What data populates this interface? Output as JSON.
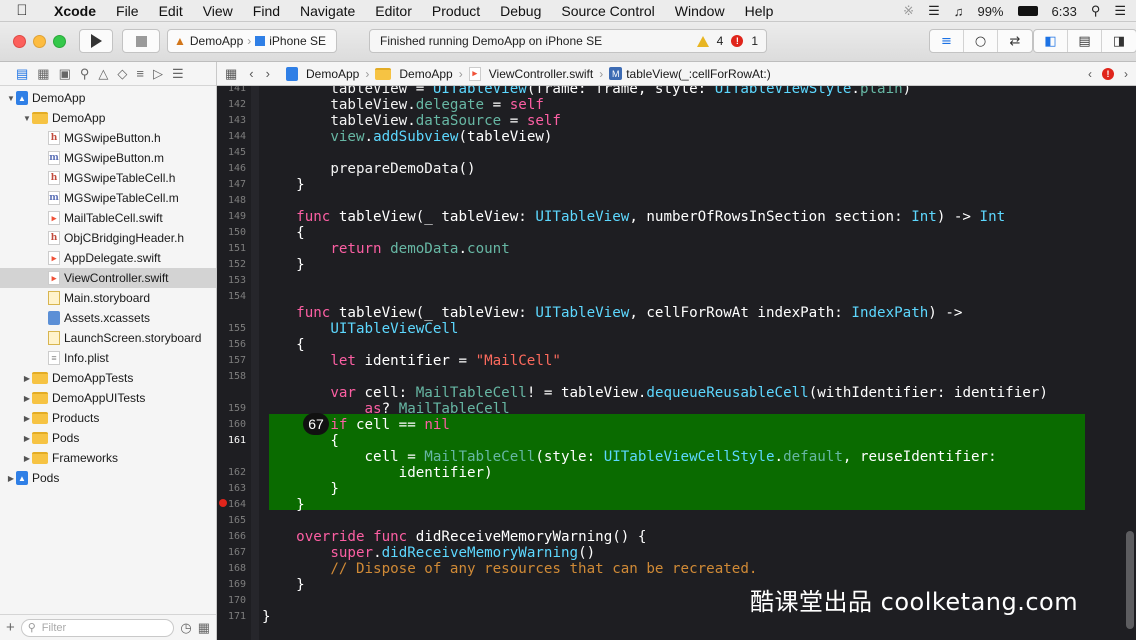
{
  "menubar": {
    "apple": "",
    "items": [
      "Xcode",
      "File",
      "Edit",
      "View",
      "Find",
      "Navigate",
      "Editor",
      "Product",
      "Debug",
      "Source Control",
      "Window",
      "Help"
    ],
    "battery": "99%",
    "time": "6:33"
  },
  "toolbar": {
    "scheme": "DemoApp",
    "device": "iPhone SE",
    "activity": "Finished running DemoApp on iPhone SE",
    "warnings": "4",
    "errors": "1"
  },
  "navigator": {
    "filter_placeholder": "Filter",
    "tree": [
      {
        "label": "DemoApp",
        "icon": "project",
        "indent": 0,
        "disclosure": "▼"
      },
      {
        "label": "DemoApp",
        "icon": "folder",
        "indent": 1,
        "disclosure": "▼"
      },
      {
        "label": "MGSwipeButton.h",
        "icon": "hfile",
        "indent": 2,
        "disclosure": ""
      },
      {
        "label": "MGSwipeButton.m",
        "icon": "mfile",
        "indent": 2,
        "disclosure": ""
      },
      {
        "label": "MGSwipeTableCell.h",
        "icon": "hfile",
        "indent": 2,
        "disclosure": ""
      },
      {
        "label": "MGSwipeTableCell.m",
        "icon": "mfile",
        "indent": 2,
        "disclosure": ""
      },
      {
        "label": "MailTableCell.swift",
        "icon": "swift",
        "indent": 2,
        "disclosure": ""
      },
      {
        "label": "ObjCBridgingHeader.h",
        "icon": "hfile",
        "indent": 2,
        "disclosure": ""
      },
      {
        "label": "AppDelegate.swift",
        "icon": "swift",
        "indent": 2,
        "disclosure": ""
      },
      {
        "label": "ViewController.swift",
        "icon": "swift",
        "indent": 2,
        "disclosure": "",
        "selected": true
      },
      {
        "label": "Main.storyboard",
        "icon": "storyboard",
        "indent": 2,
        "disclosure": ""
      },
      {
        "label": "Assets.xcassets",
        "icon": "assets",
        "indent": 2,
        "disclosure": ""
      },
      {
        "label": "LaunchScreen.storyboard",
        "icon": "storyboard",
        "indent": 2,
        "disclosure": ""
      },
      {
        "label": "Info.plist",
        "icon": "plist",
        "indent": 2,
        "disclosure": ""
      },
      {
        "label": "DemoAppTests",
        "icon": "folder",
        "indent": 1,
        "disclosure": "▶"
      },
      {
        "label": "DemoAppUITests",
        "icon": "folder",
        "indent": 1,
        "disclosure": "▶"
      },
      {
        "label": "Products",
        "icon": "folder",
        "indent": 1,
        "disclosure": "▶"
      },
      {
        "label": "Pods",
        "icon": "folder",
        "indent": 1,
        "disclosure": "▶"
      },
      {
        "label": "Frameworks",
        "icon": "folder",
        "indent": 1,
        "disclosure": "▶"
      },
      {
        "label": "Pods",
        "icon": "project",
        "indent": 0,
        "disclosure": "▶"
      }
    ]
  },
  "jumpbar": {
    "crumbs": [
      "DemoApp",
      "DemoApp",
      "ViewController.swift",
      "tableView(_:cellForRowAt:)"
    ]
  },
  "editor": {
    "step_badge": "67",
    "current_line": "161",
    "error_line": "163",
    "line_numbers": [
      "141",
      "142",
      "143",
      "144",
      "145",
      "146",
      "147",
      "148",
      "149",
      "150",
      "151",
      "152",
      "153",
      "154",
      "",
      "155",
      "156",
      "157",
      "158",
      "",
      "159",
      "160",
      "161",
      "",
      "162",
      "163",
      "164",
      "165",
      "166",
      "167",
      "168",
      "169",
      "170",
      "171"
    ],
    "lines": [
      [
        [
          "        ",
          ""
        ],
        [
          "tableView",
          "df"
        ],
        [
          " = ",
          ""
        ],
        [
          "UITableView",
          "ty"
        ],
        [
          "(frame: frame, style: ",
          ""
        ],
        [
          "UITableViewStyle",
          "ty"
        ],
        [
          ".",
          ""
        ],
        [
          "plain",
          "pm"
        ],
        [
          ")",
          ""
        ]
      ],
      [
        [
          "        ",
          ""
        ],
        [
          "tableView",
          "df"
        ],
        [
          ".",
          ""
        ],
        [
          "delegate",
          "pm"
        ],
        [
          " = ",
          ""
        ],
        [
          "self",
          "kw"
        ]
      ],
      [
        [
          "        ",
          ""
        ],
        [
          "tableView",
          "df"
        ],
        [
          ".",
          ""
        ],
        [
          "dataSource",
          "pm"
        ],
        [
          " = ",
          ""
        ],
        [
          "self",
          "kw"
        ]
      ],
      [
        [
          "        ",
          ""
        ],
        [
          "view",
          "pm"
        ],
        [
          ".",
          ""
        ],
        [
          "addSubview",
          "fn"
        ],
        [
          "(tableView)",
          ""
        ]
      ],
      [
        [
          "",
          ""
        ]
      ],
      [
        [
          "        ",
          ""
        ],
        [
          "prepareDemoData",
          "df"
        ],
        [
          "()",
          ""
        ]
      ],
      [
        [
          "    }",
          ""
        ]
      ],
      [
        [
          "",
          ""
        ]
      ],
      [
        [
          "    ",
          ""
        ],
        [
          "func",
          "kw"
        ],
        [
          " tableView(_ tableView: ",
          ""
        ],
        [
          "UITableView",
          "ty"
        ],
        [
          ", numberOfRowsInSection section: ",
          ""
        ],
        [
          "Int",
          "ty"
        ],
        [
          ") -> ",
          ""
        ],
        [
          "Int",
          "ty"
        ]
      ],
      [
        [
          "    {",
          ""
        ]
      ],
      [
        [
          "        ",
          ""
        ],
        [
          "return",
          "kw"
        ],
        [
          " ",
          ""
        ],
        [
          "demoData",
          "pm"
        ],
        [
          ".",
          ""
        ],
        [
          "count",
          "pm"
        ]
      ],
      [
        [
          "    }",
          ""
        ]
      ],
      [
        [
          "",
          ""
        ]
      ],
      [
        [
          "",
          ""
        ]
      ],
      [
        [
          "    ",
          ""
        ],
        [
          "func",
          "kw"
        ],
        [
          " tableView(_ tableView: ",
          ""
        ],
        [
          "UITableView",
          "ty"
        ],
        [
          ", cellForRowAt indexPath: ",
          ""
        ],
        [
          "IndexPath",
          "ty"
        ],
        [
          ") ->",
          ""
        ]
      ],
      [
        [
          "        ",
          ""
        ],
        [
          "UITableViewCell",
          "ty"
        ]
      ],
      [
        [
          "    {",
          ""
        ]
      ],
      [
        [
          "        ",
          ""
        ],
        [
          "let",
          "kw"
        ],
        [
          " identifier = ",
          ""
        ],
        [
          "\"MailCell\"",
          "st"
        ]
      ],
      [
        [
          "",
          ""
        ]
      ],
      [
        [
          "        ",
          ""
        ],
        [
          "var",
          "kw"
        ],
        [
          " cell: ",
          ""
        ],
        [
          "MailTableCell",
          "pm"
        ],
        [
          "! = tableView.",
          ""
        ],
        [
          "dequeueReusableCell",
          "fn"
        ],
        [
          "(withIdentifier: identifier)",
          ""
        ]
      ],
      [
        [
          "            ",
          ""
        ],
        [
          "as",
          "kw"
        ],
        [
          "? ",
          ""
        ],
        [
          "MailTableCell",
          "pm"
        ]
      ],
      [
        [
          "        ",
          ""
        ],
        [
          "if",
          "kw"
        ],
        [
          " cell == ",
          ""
        ],
        [
          "nil",
          "kw"
        ]
      ],
      [
        [
          "        {",
          ""
        ]
      ],
      [
        [
          "            cell = ",
          ""
        ],
        [
          "MailTableCell",
          "pm"
        ],
        [
          "(style: ",
          ""
        ],
        [
          "UITableViewCellStyle",
          "ty"
        ],
        [
          ".",
          ""
        ],
        [
          "default",
          "pm"
        ],
        [
          ", reuseIdentifier:",
          ""
        ]
      ],
      [
        [
          "                identifier)",
          ""
        ]
      ],
      [
        [
          "        }",
          ""
        ]
      ],
      [
        [
          "    }",
          ""
        ]
      ],
      [
        [
          "",
          ""
        ]
      ],
      [
        [
          "    ",
          ""
        ],
        [
          "override",
          "kw"
        ],
        [
          " ",
          ""
        ],
        [
          "func",
          "kw"
        ],
        [
          " didReceiveMemoryWarning() {",
          ""
        ]
      ],
      [
        [
          "        ",
          ""
        ],
        [
          "super",
          "kw"
        ],
        [
          ".",
          ""
        ],
        [
          "didReceiveMemoryWarning",
          "fn"
        ],
        [
          "()",
          ""
        ]
      ],
      [
        [
          "        ",
          ""
        ],
        [
          "// Dispose of any resources that can be recreated.",
          "cm"
        ]
      ],
      [
        [
          "    }",
          ""
        ]
      ],
      [
        [
          "",
          ""
        ]
      ],
      [
        [
          "}",
          ""
        ]
      ],
      [
        [
          "",
          ""
        ]
      ]
    ]
  },
  "watermark": "酷课堂出品 coolketang.com"
}
